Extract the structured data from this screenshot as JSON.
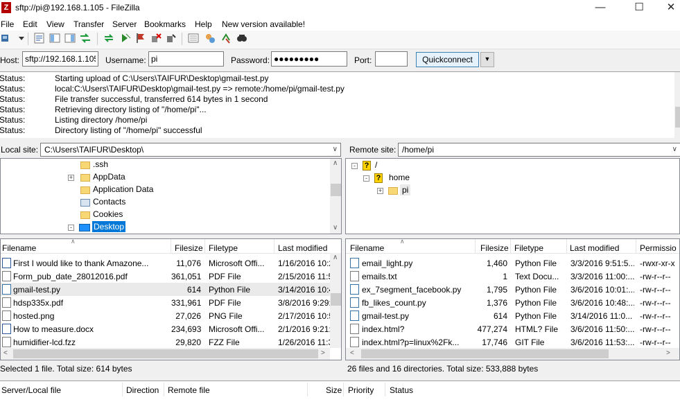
{
  "window": {
    "title": "sftp://pi@192.168.1.105 - FileZilla",
    "app_icon": "Z"
  },
  "menu": [
    "File",
    "Edit",
    "View",
    "Transfer",
    "Server",
    "Bookmarks",
    "Help",
    "New version available!"
  ],
  "quickconnect": {
    "host_label": "Host:",
    "host_value": "sftp://192.168.1.105",
    "username_label": "Username:",
    "username_value": "pi",
    "password_label": "Password:",
    "password_value": "●●●●●●●●●",
    "port_label": "Port:",
    "port_value": "",
    "button": "Quickconnect"
  },
  "log": [
    {
      "k": "Status:",
      "v": "Starting upload of C:\\Users\\TAIFUR\\Desktop\\gmail-test.py"
    },
    {
      "k": "Status:",
      "v": "local:C:\\Users\\TAIFUR\\Desktop\\gmail-test.py => remote:/home/pi/gmail-test.py"
    },
    {
      "k": "Status:",
      "v": "File transfer successful, transferred 614 bytes in 1 second"
    },
    {
      "k": "Status:",
      "v": "Retrieving directory listing of \"/home/pi\"..."
    },
    {
      "k": "Status:",
      "v": "Listing directory /home/pi"
    },
    {
      "k": "Status:",
      "v": "Directory listing of \"/home/pi\" successful"
    }
  ],
  "local": {
    "site_label": "Local site:",
    "site_path": "C:\\Users\\TAIFUR\\Desktop\\",
    "tree": [
      {
        "label": ".ssh",
        "expander": ""
      },
      {
        "label": "AppData",
        "expander": "+"
      },
      {
        "label": "Application Data",
        "expander": ""
      },
      {
        "label": "Contacts",
        "expander": ""
      },
      {
        "label": "Cookies",
        "expander": ""
      },
      {
        "label": "Desktop",
        "expander": "-"
      }
    ],
    "columns": [
      "Filename",
      "Filesize",
      "Filetype",
      "Last modified"
    ],
    "files": [
      {
        "name": "First I would like to thank Amazone...",
        "size": "11,076",
        "type": "Microsoft Offi...",
        "modified": "1/16/2016 10:2"
      },
      {
        "name": "Form_pub_date_28012016.pdf",
        "size": "361,051",
        "type": "PDF File",
        "modified": "2/15/2016 11:5"
      },
      {
        "name": "gmail-test.py",
        "size": "614",
        "type": "Python File",
        "modified": "3/14/2016 10:4"
      },
      {
        "name": "hdsp335x.pdf",
        "size": "331,961",
        "type": "PDF File",
        "modified": "3/8/2016 9:29:"
      },
      {
        "name": "hosted.png",
        "size": "27,026",
        "type": "PNG File",
        "modified": "2/17/2016 10:5"
      },
      {
        "name": "How to measure.docx",
        "size": "234,693",
        "type": "Microsoft Offi...",
        "modified": "2/1/2016 9:21:"
      },
      {
        "name": "humidifier-lcd.fzz",
        "size": "29,820",
        "type": "FZZ File",
        "modified": "1/26/2016 11:3"
      }
    ],
    "status": "Selected 1 file. Total size: 614 bytes"
  },
  "remote": {
    "site_label": "Remote site:",
    "site_path": "/home/pi",
    "tree": [
      {
        "label": "/",
        "expander": "-"
      },
      {
        "label": "home",
        "expander": "-"
      },
      {
        "label": "pi",
        "expander": "+"
      }
    ],
    "columns": [
      "Filename",
      "Filesize",
      "Filetype",
      "Last modified",
      "Permissio"
    ],
    "files": [
      {
        "name": "email_light.py",
        "size": "1,460",
        "type": "Python File",
        "modified": "3/3/2016 9:51:5...",
        "perm": "-rwxr-xr-x"
      },
      {
        "name": "emails.txt",
        "size": "1",
        "type": "Text Docu...",
        "modified": "3/3/2016 11:00:...",
        "perm": "-rw-r--r--"
      },
      {
        "name": "ex_7segment_facebook.py",
        "size": "1,795",
        "type": "Python File",
        "modified": "3/6/2016 10:01:...",
        "perm": "-rw-r--r--"
      },
      {
        "name": "fb_likes_count.py",
        "size": "1,376",
        "type": "Python File",
        "modified": "3/6/2016 10:48:...",
        "perm": "-rw-r--r--"
      },
      {
        "name": "gmail-test.py",
        "size": "614",
        "type": "Python File",
        "modified": "3/14/2016 11:0...",
        "perm": "-rw-r--r--"
      },
      {
        "name": "index.html?",
        "size": "477,274",
        "type": "HTML? File",
        "modified": "3/6/2016 11:50:...",
        "perm": "-rw-r--r--"
      },
      {
        "name": "index.html?p=linux%2Fk...",
        "size": "17,746",
        "type": "GIT File",
        "modified": "3/6/2016 11:53:...",
        "perm": "-rw-r--r--"
      }
    ],
    "status": "26 files and 16 directories. Total size: 533,888 bytes"
  },
  "queue": {
    "columns": [
      "Server/Local file",
      "Direction",
      "Remote file",
      "Size",
      "Priority",
      "Status"
    ]
  }
}
